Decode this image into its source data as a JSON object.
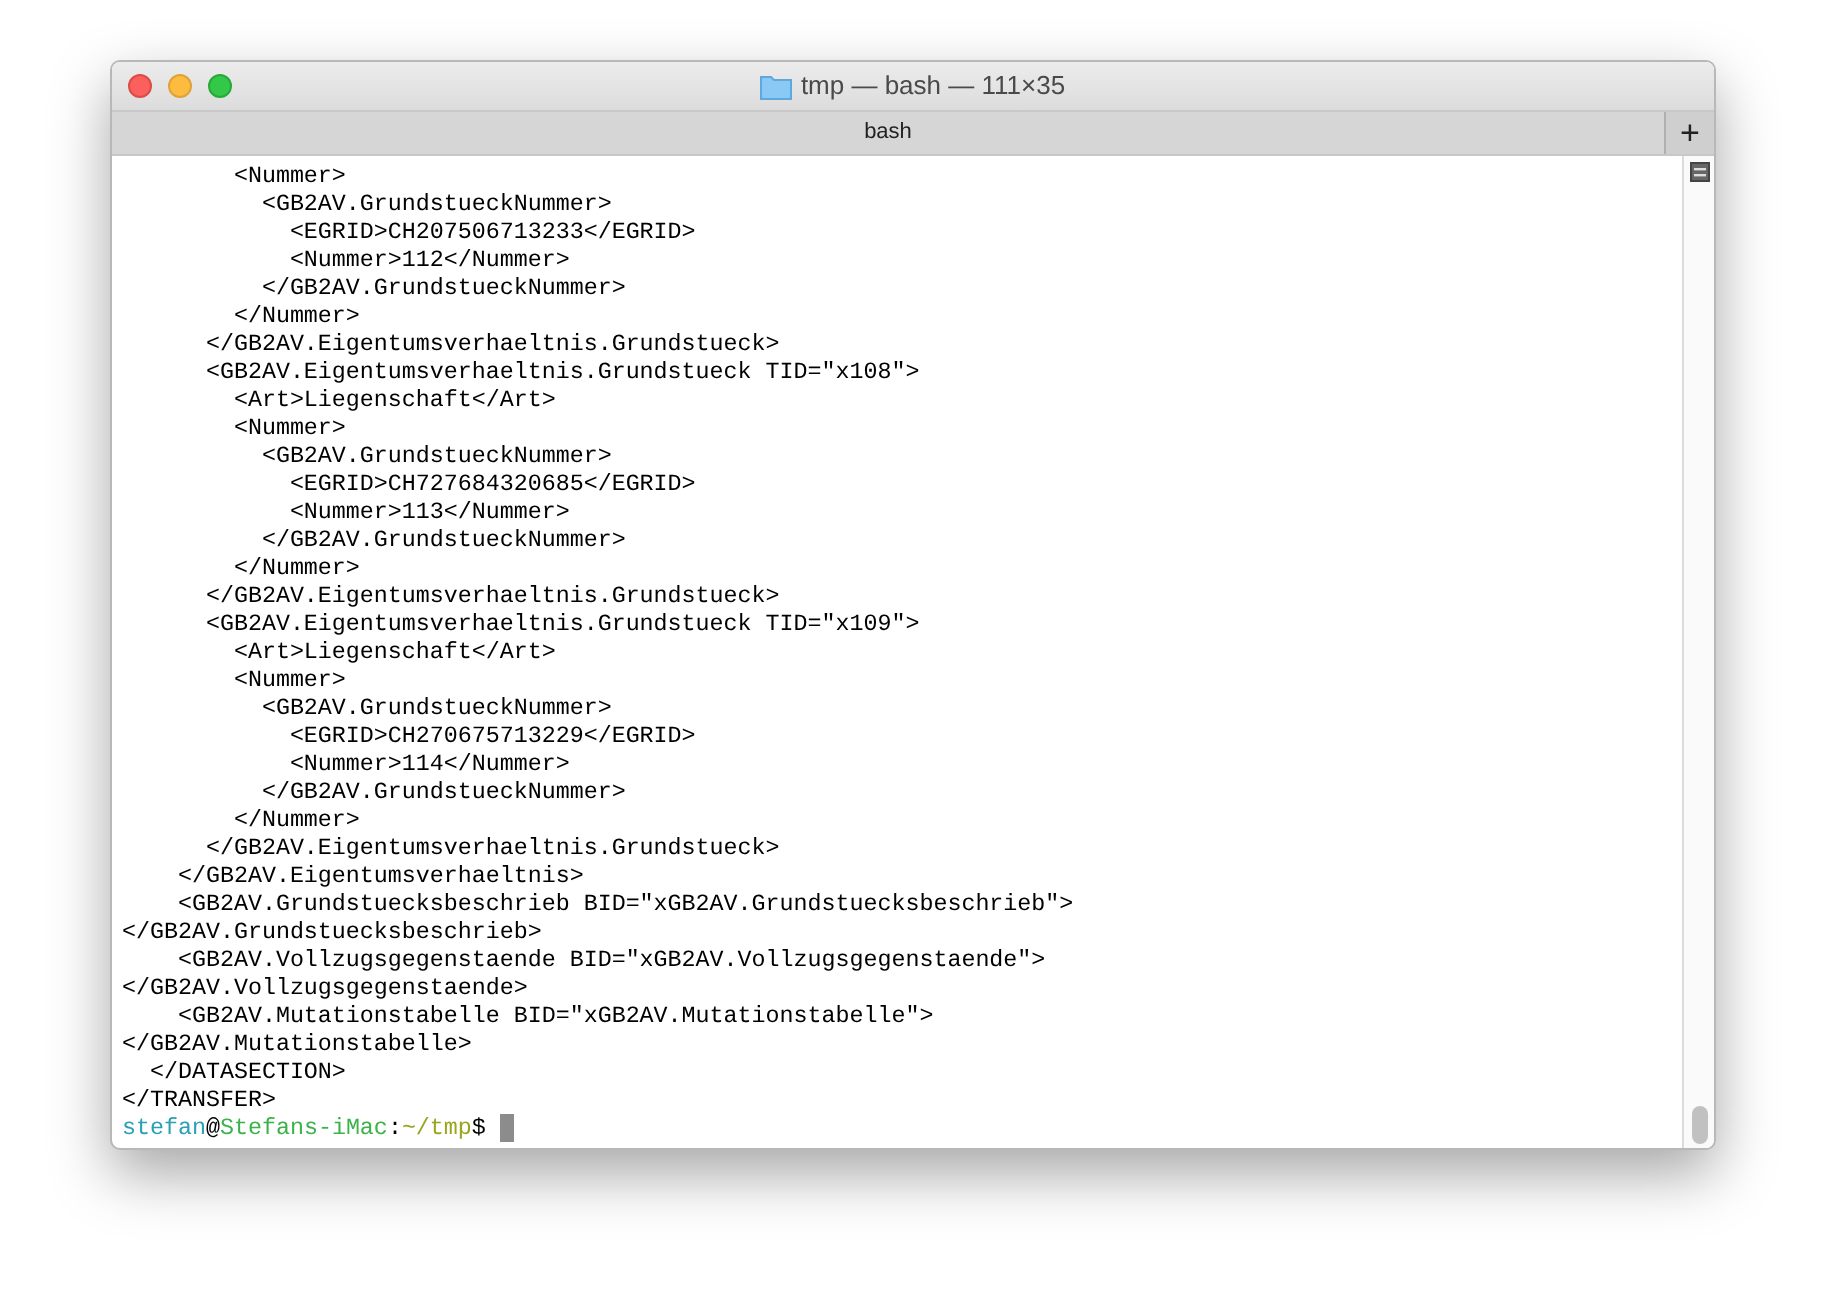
{
  "window": {
    "title": "tmp — bash — 111×35"
  },
  "tab": {
    "label": "bash"
  },
  "new_tab_button": {
    "label": "+"
  },
  "terminal": {
    "lines": [
      "        <Nummer>",
      "          <GB2AV.GrundstueckNummer>",
      "            <EGRID>CH207506713233</EGRID>",
      "            <Nummer>112</Nummer>",
      "          </GB2AV.GrundstueckNummer>",
      "        </Nummer>",
      "      </GB2AV.Eigentumsverhaeltnis.Grundstueck>",
      "      <GB2AV.Eigentumsverhaeltnis.Grundstueck TID=\"x108\">",
      "        <Art>Liegenschaft</Art>",
      "        <Nummer>",
      "          <GB2AV.GrundstueckNummer>",
      "            <EGRID>CH727684320685</EGRID>",
      "            <Nummer>113</Nummer>",
      "          </GB2AV.GrundstueckNummer>",
      "        </Nummer>",
      "      </GB2AV.Eigentumsverhaeltnis.Grundstueck>",
      "      <GB2AV.Eigentumsverhaeltnis.Grundstueck TID=\"x109\">",
      "        <Art>Liegenschaft</Art>",
      "        <Nummer>",
      "          <GB2AV.GrundstueckNummer>",
      "            <EGRID>CH270675713229</EGRID>",
      "            <Nummer>114</Nummer>",
      "          </GB2AV.GrundstueckNummer>",
      "        </Nummer>",
      "      </GB2AV.Eigentumsverhaeltnis.Grundstueck>",
      "    </GB2AV.Eigentumsverhaeltnis>",
      "    <GB2AV.Grundstuecksbeschrieb BID=\"xGB2AV.Grundstuecksbeschrieb\">",
      "</GB2AV.Grundstuecksbeschrieb>",
      "    <GB2AV.Vollzugsgegenstaende BID=\"xGB2AV.Vollzugsgegenstaende\">",
      "</GB2AV.Vollzugsgegenstaende>",
      "    <GB2AV.Mutationstabelle BID=\"xGB2AV.Mutationstabelle\">",
      "</GB2AV.Mutationstabelle>",
      "  </DATASECTION>",
      "</TRANSFER>"
    ],
    "prompt": [
      {
        "kind": "user",
        "text": "stefan"
      },
      {
        "kind": "plain",
        "text": "@"
      },
      {
        "kind": "host",
        "text": "Stefans-iMac"
      },
      {
        "kind": "plain",
        "text": ":"
      },
      {
        "kind": "path",
        "text": "~/tmp"
      },
      {
        "kind": "plain",
        "text": "$"
      }
    ]
  }
}
